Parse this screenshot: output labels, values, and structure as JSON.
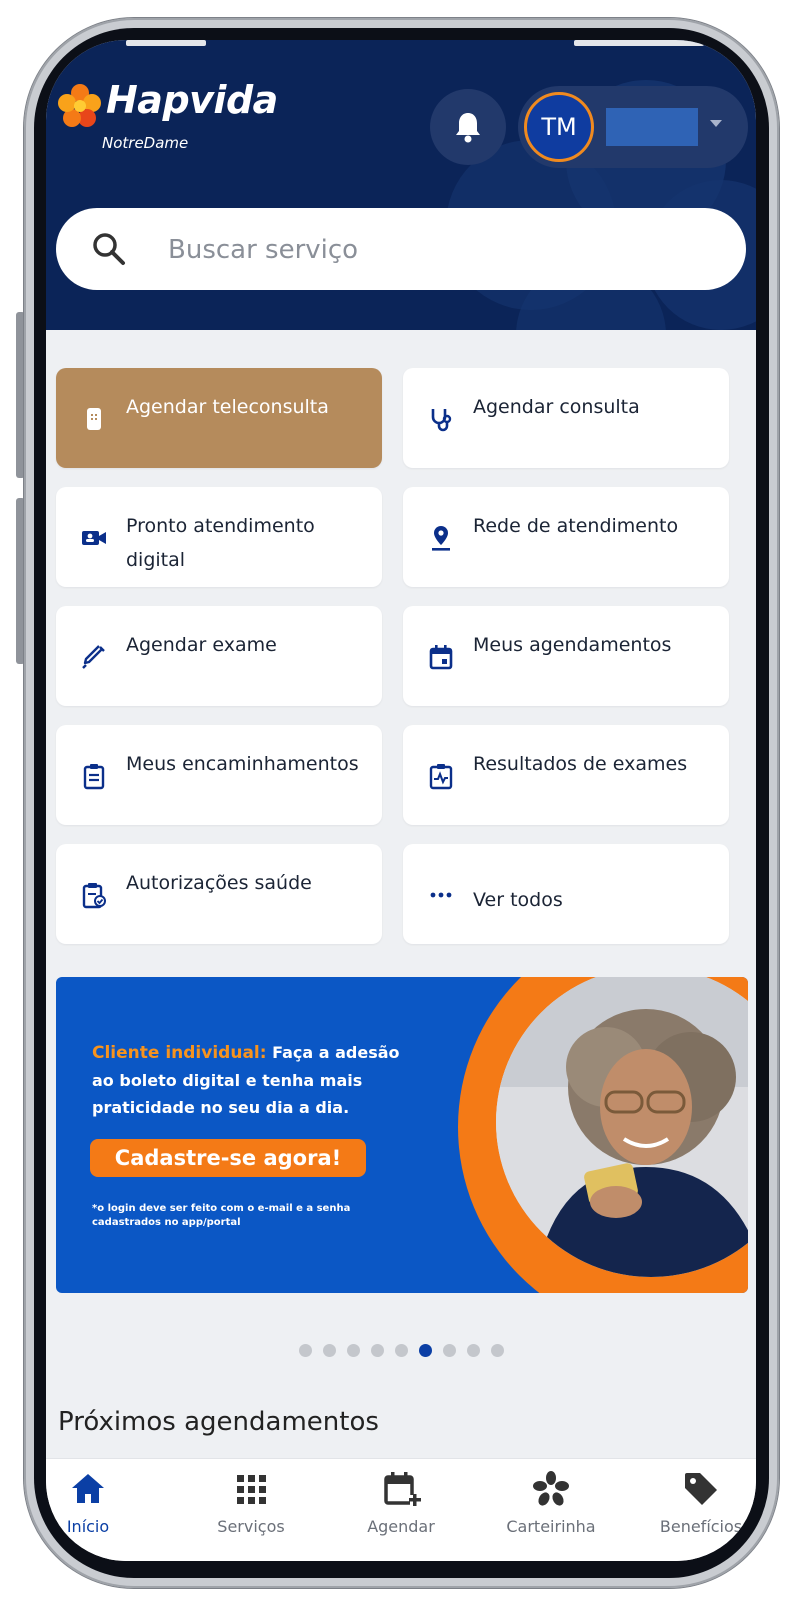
{
  "header": {
    "brand": "Hapvida",
    "sub_brand": "NotreDame",
    "avatar_initials": "TM"
  },
  "search": {
    "placeholder": "Buscar serviço"
  },
  "services": [
    {
      "label": "Agendar teleconsulta",
      "icon": "teleconsult-icon"
    },
    {
      "label": "Agendar consulta",
      "icon": "stethoscope-icon"
    },
    {
      "label": "Pronto atendimento digital",
      "icon": "video-call-icon"
    },
    {
      "label": "Rede de atendimento",
      "icon": "location-pin-icon"
    },
    {
      "label": "Agendar exame",
      "icon": "syringe-icon"
    },
    {
      "label": "Meus agendamentos",
      "icon": "calendar-icon"
    },
    {
      "label": "Meus encaminhamentos",
      "icon": "clipboard-icon"
    },
    {
      "label": "Resultados de exames",
      "icon": "exam-results-icon"
    },
    {
      "label": "Autorizações saúde",
      "icon": "authorization-icon"
    },
    {
      "label": "Ver todos",
      "icon": "more-dots-icon"
    }
  ],
  "banner": {
    "highlight": "Cliente individual:",
    "text": " Faça a adesão ao boleto digital e tenha mais praticidade no seu dia a dia.",
    "cta": "Cadastre-se agora!",
    "note": "*o login deve ser feito com o e-mail e a senha cadastrados no app/portal"
  },
  "carousel": {
    "total": 9,
    "active": 6
  },
  "section": {
    "title": "Próximos agendamentos"
  },
  "nav": [
    {
      "label": "Início",
      "icon": "home-icon",
      "active": true
    },
    {
      "label": "Serviços",
      "icon": "grid-icon",
      "active": false
    },
    {
      "label": "Agendar",
      "icon": "calendar-plus-icon",
      "active": false
    },
    {
      "label": "Carteirinha",
      "icon": "card-flower-icon",
      "active": false
    },
    {
      "label": "Benefícios",
      "icon": "tag-icon",
      "active": false
    }
  ],
  "colors": {
    "header_bg": "#0b2458",
    "primary_card": "#b58b5c",
    "accent_orange": "#f47a16",
    "accent_blue": "#0b3fa5"
  }
}
